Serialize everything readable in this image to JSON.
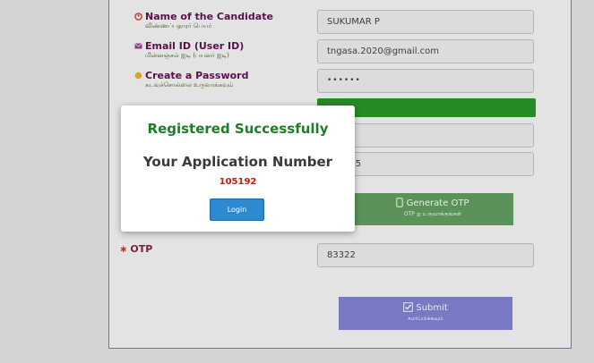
{
  "form": {
    "candidate_name": {
      "label": "Name of the Candidate",
      "label_ta": "விண்ணப்பதாரர் பெயர்",
      "value": "SUKUMAR P"
    },
    "email": {
      "label": "Email ID (User ID)",
      "label_ta": "மின்னஞ்சல் ஐடி (பயனர் ஐடி)",
      "value": "tngasa.2020@gmail.com"
    },
    "password": {
      "label": "Create a Password",
      "label_ta": "கடவுச்சொல்லை உருவாக்கவும்",
      "value": "••••••"
    },
    "partial_field_1": "•",
    "partial_field_2": "952245",
    "otp": {
      "label": "OTP",
      "value": "83322"
    },
    "generate_otp": {
      "label": "Generate OTP",
      "label_ta": "OTP ஐ உருவாக்குங்கள்"
    },
    "submit": {
      "label": "Submit",
      "label_ta": "சமர்ப்பிக்கவும்"
    }
  },
  "modal": {
    "title": "Registered Successfully",
    "app_number_label": "Your Application Number",
    "app_number": "105192",
    "login_label": "Login"
  },
  "colors": {
    "success_green": "#1f7d2a",
    "app_number_red": "#d11313",
    "login_blue": "#2e8ad0",
    "label_maroon": "#58104d"
  }
}
